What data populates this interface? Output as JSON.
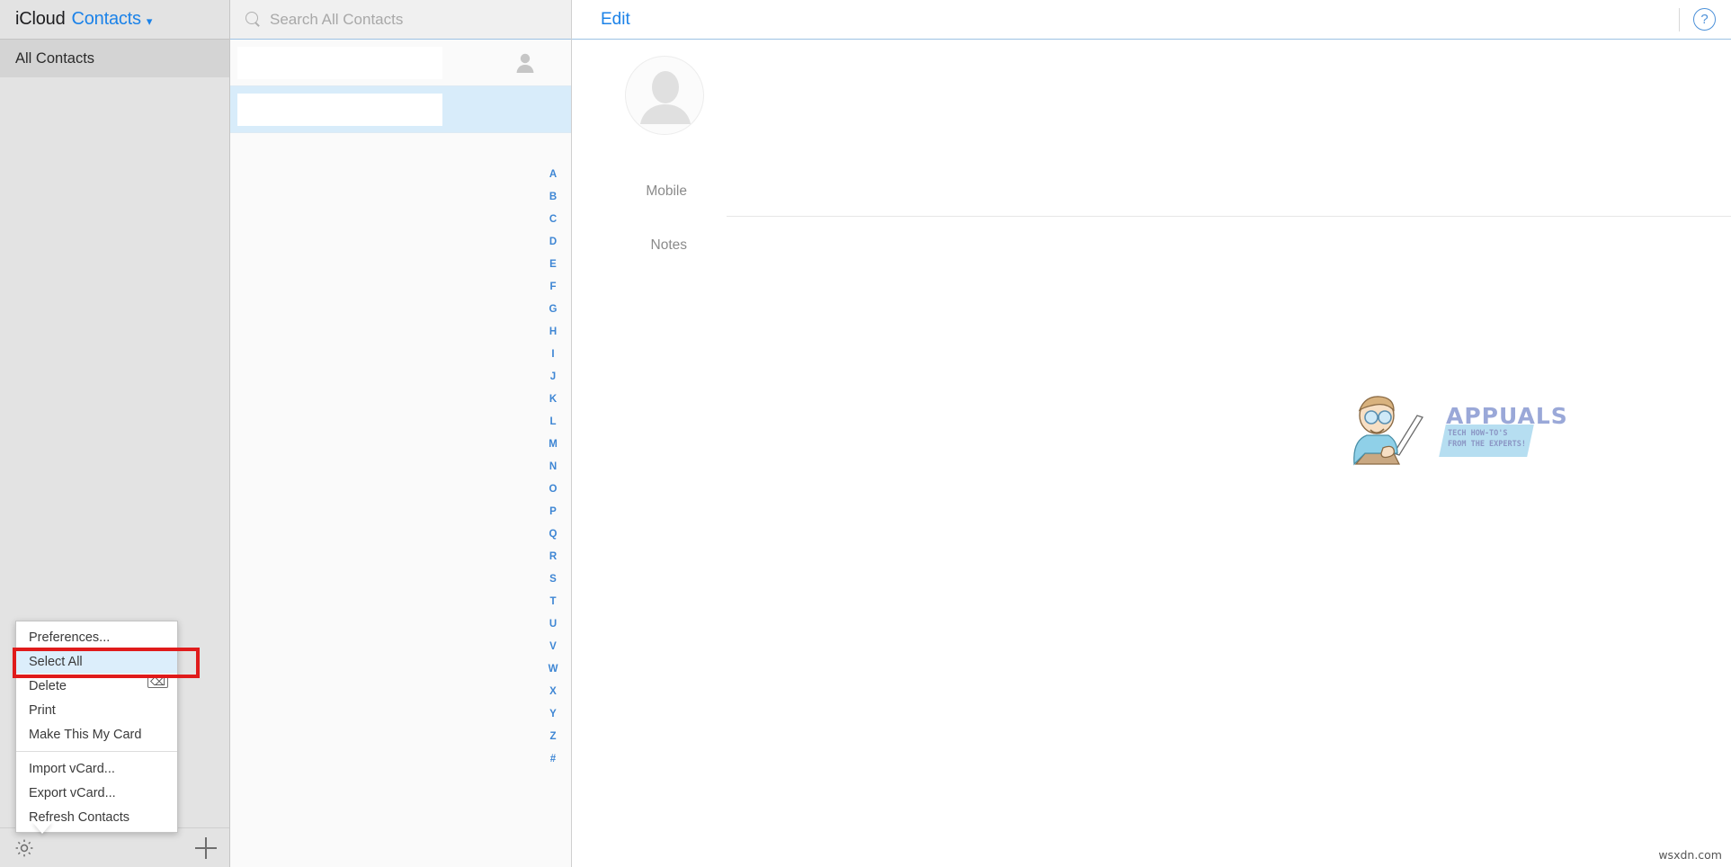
{
  "window": {
    "brand": "iCloud",
    "app_name": "Contacts",
    "chevron_icon": "chevron-down-icon",
    "site_credit": "wsxdn.com"
  },
  "sidebar": {
    "groups": [
      {
        "label": "All Contacts",
        "selected": true
      }
    ],
    "toolbar": {
      "settings_icon": "gear-icon",
      "add_icon": "plus-icon"
    }
  },
  "popup_menu": {
    "visible": true,
    "highlight_color": "#dceefb",
    "annotation_color": "#e01b1b",
    "items": [
      {
        "label": "Preferences...",
        "shortcut": "",
        "highlighted": false,
        "separator_after": false
      },
      {
        "label": "Select All",
        "shortcut": "",
        "highlighted": true,
        "separator_after": false
      },
      {
        "label": "Delete",
        "shortcut": "⌫",
        "highlighted": false,
        "separator_after": false
      },
      {
        "label": "Print",
        "shortcut": "",
        "highlighted": false,
        "separator_after": false
      },
      {
        "label": "Make This My Card",
        "shortcut": "",
        "highlighted": false,
        "separator_after": true
      },
      {
        "label": "Import vCard...",
        "shortcut": "",
        "highlighted": false,
        "separator_after": false
      },
      {
        "label": "Export vCard...",
        "shortcut": "",
        "highlighted": false,
        "separator_after": false
      },
      {
        "label": "Refresh Contacts",
        "shortcut": "",
        "highlighted": false,
        "separator_after": false
      }
    ]
  },
  "search": {
    "icon": "search-icon",
    "placeholder": "Search All Contacts",
    "value": ""
  },
  "contact_list": {
    "rows": [
      {
        "name": "",
        "redacted": true,
        "selected": false,
        "has_person_icon": true
      },
      {
        "name": "",
        "redacted": true,
        "selected": true,
        "has_person_icon": false
      }
    ],
    "alphabet_index": [
      "A",
      "B",
      "C",
      "D",
      "E",
      "F",
      "G",
      "H",
      "I",
      "J",
      "K",
      "L",
      "M",
      "N",
      "O",
      "P",
      "Q",
      "R",
      "S",
      "T",
      "U",
      "V",
      "W",
      "X",
      "Y",
      "Z",
      "#"
    ]
  },
  "detail": {
    "edit_label": "Edit",
    "help_icon": "help-circle-icon",
    "avatar_icon": "person-placeholder-icon",
    "fields": [
      {
        "label": "Mobile",
        "value": ""
      },
      {
        "label": "Notes",
        "value": ""
      }
    ]
  },
  "watermark": {
    "title": "APPUALS",
    "tagline": "TECH HOW-TO'S FROM THE EXPERTS!",
    "accent_color": "#a9d8ef",
    "title_color": "#9aa8d8"
  }
}
